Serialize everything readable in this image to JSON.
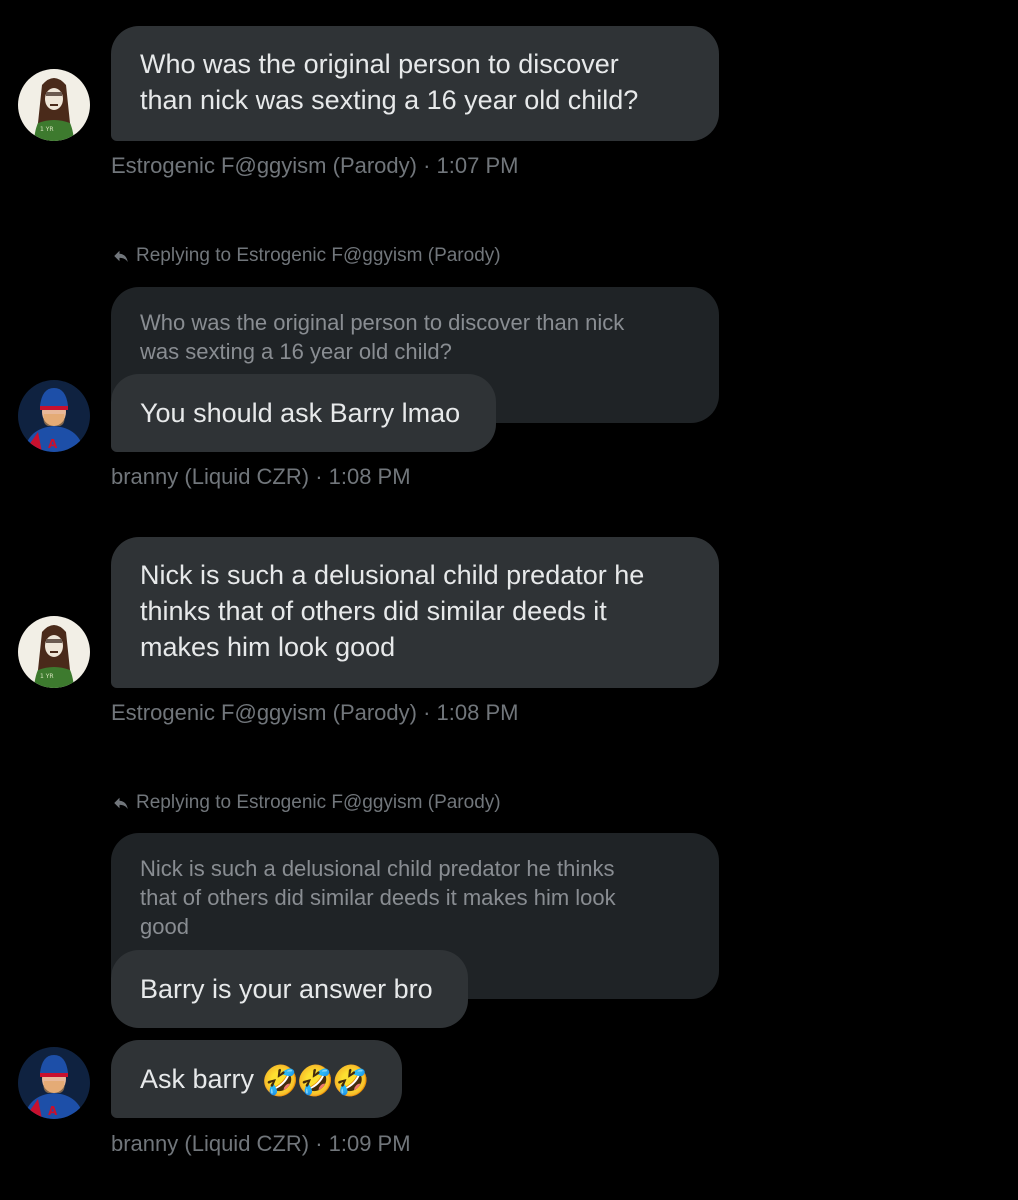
{
  "messages": [
    {
      "text_lines": [
        "Who was the original person to discover",
        "than nick was sexting a 16 year old child?"
      ],
      "meta": "Estrogenic F@ggyism (Parody) · 1:07 PM",
      "avatar": "parody-avatar"
    },
    {
      "reply_label": "Replying to Estrogenic F@ggyism (Parody)",
      "quoted_lines": [
        "Who was the original person to discover than nick",
        "was sexting a 16 year old child?"
      ],
      "text": "You should ask Barry lmao",
      "meta": "branny (Liquid CZR) · 1:08 PM",
      "avatar": "hockey-player-avatar"
    },
    {
      "text_lines": [
        "Nick is such a delusional child predator he",
        "thinks that of others did similar deeds it",
        "makes him look good"
      ],
      "meta": "Estrogenic F@ggyism (Parody) · 1:08 PM",
      "avatar": "parody-avatar"
    },
    {
      "reply_label": "Replying to Estrogenic F@ggyism (Parody)",
      "quoted_lines": [
        "Nick is such a delusional child predator he thinks",
        "that of others did similar deeds it makes him look",
        "good"
      ],
      "text": "Barry is your answer bro",
      "text2": "Ask barry",
      "emoji": "🤣🤣🤣",
      "meta": "branny (Liquid CZR) · 1:09 PM",
      "avatar": "hockey-player-avatar"
    }
  ],
  "colors": {
    "background": "#000000",
    "bubble": "#2f3336",
    "quote_bubble": "#1f2326",
    "meta_text": "#71767b"
  }
}
